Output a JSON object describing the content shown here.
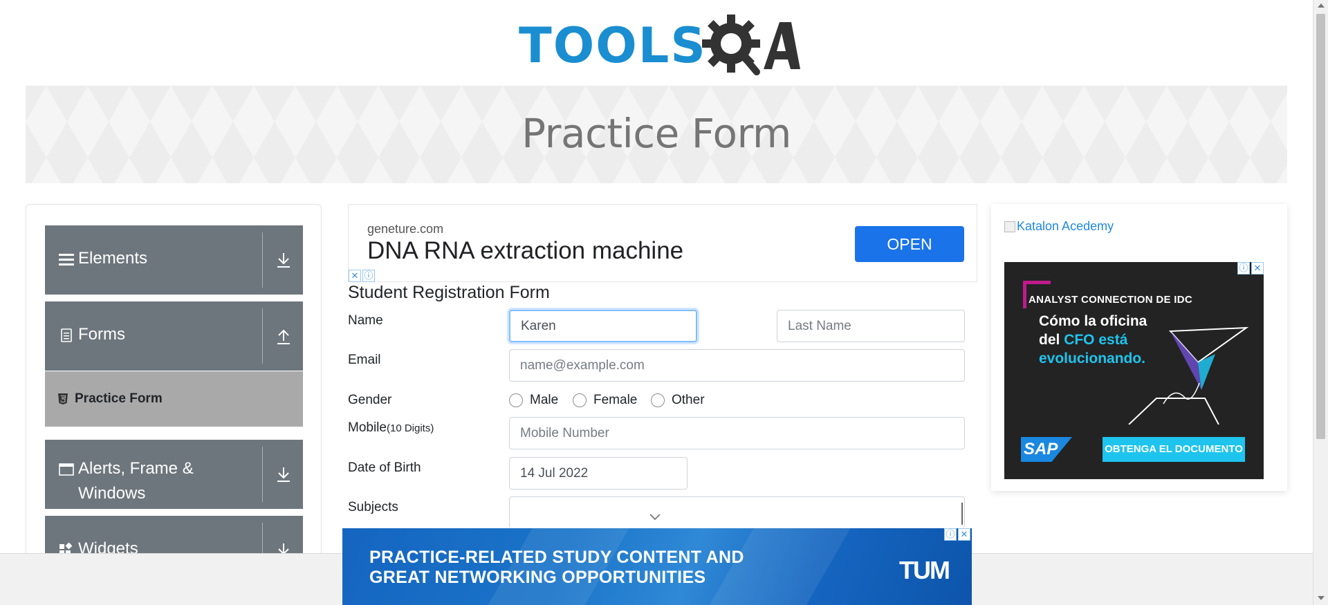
{
  "header": {
    "logo_text": "TOOLS",
    "logo_suffix": "A"
  },
  "banner": {
    "title": "Practice Form"
  },
  "sidebar": {
    "groups": [
      {
        "label": "Elements",
        "icon": "hamburger-icon",
        "arrow": "download-arrow-icon"
      },
      {
        "label": "Forms",
        "icon": "document-icon",
        "arrow": "upload-arrow-icon"
      },
      {
        "label_line1": "Alerts, Frame &",
        "label_line2": "Windows",
        "icon": "window-icon",
        "arrow": "download-arrow-icon"
      },
      {
        "label": "Widgets",
        "icon": "widgets-icon",
        "arrow": "download-arrow-icon"
      }
    ],
    "active_item": {
      "label": "Practice Form",
      "icon": "html5-icon"
    }
  },
  "top_ad": {
    "domain": "geneture.com",
    "headline": "DNA RNA extraction machine",
    "button": "OPEN"
  },
  "form": {
    "title": "Student Registration Form",
    "labels": {
      "name": "Name",
      "email": "Email",
      "gender": "Gender",
      "mobile": "Mobile",
      "mobile_hint": "(10 Digits)",
      "dob": "Date of Birth",
      "subjects": "Subjects"
    },
    "first_name": {
      "value": "Karen"
    },
    "last_name": {
      "placeholder": "Last Name"
    },
    "email": {
      "placeholder": "name@example.com"
    },
    "gender_options": [
      "Male",
      "Female",
      "Other"
    ],
    "mobile": {
      "placeholder": "Mobile Number"
    },
    "dob": {
      "value": "14 Jul 2022"
    }
  },
  "right_ad": {
    "link_text": "Katalon Acedemy",
    "kicker": "ANALYST CONNECTION DE IDC",
    "line1": "Cómo la oficina",
    "line2_pre": "del ",
    "line2_hl": "CFO está",
    "line3": "evolucionando.",
    "brand": "SAP",
    "cta": "OBTENGA EL DOCUMENTO",
    "accent_color": "#1ec4ee"
  },
  "bottom_ad": {
    "line1": "PRACTICE-RELATED STUDY CONTENT AND",
    "line2": "GREAT NETWORKING OPPORTUNITIES",
    "brand": "TUM"
  }
}
